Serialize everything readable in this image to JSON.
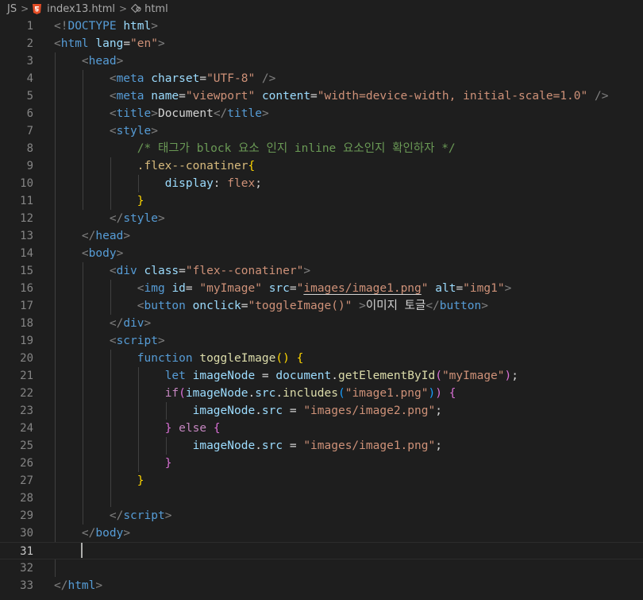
{
  "breadcrumb": {
    "root": "JS",
    "file": "index13.html",
    "element": "html",
    "file_icon": "html5-icon",
    "element_icon": "tag-icon"
  },
  "editor": {
    "active_line": 31,
    "lines": [
      [
        {
          "t": "<!",
          "c": "t-punc"
        },
        {
          "t": "DOCTYPE",
          "c": "t-tag"
        },
        {
          "t": " ",
          "c": "t-text"
        },
        {
          "t": "html",
          "c": "t-attr"
        },
        {
          "t": ">",
          "c": "t-punc"
        }
      ],
      [
        {
          "t": "<",
          "c": "t-punc"
        },
        {
          "t": "html",
          "c": "t-tag"
        },
        {
          "t": " ",
          "c": "t-text"
        },
        {
          "t": "lang",
          "c": "t-attr"
        },
        {
          "t": "=",
          "c": "t-text"
        },
        {
          "t": "\"en\"",
          "c": "t-str"
        },
        {
          "t": ">",
          "c": "t-punc"
        }
      ],
      [
        {
          "t": "    ",
          "c": "t-text"
        },
        {
          "t": "<",
          "c": "t-punc"
        },
        {
          "t": "head",
          "c": "t-tag"
        },
        {
          "t": ">",
          "c": "t-punc"
        }
      ],
      [
        {
          "t": "        ",
          "c": "t-text"
        },
        {
          "t": "<",
          "c": "t-punc"
        },
        {
          "t": "meta",
          "c": "t-tag"
        },
        {
          "t": " ",
          "c": "t-text"
        },
        {
          "t": "charset",
          "c": "t-attr"
        },
        {
          "t": "=",
          "c": "t-text"
        },
        {
          "t": "\"UTF-8\"",
          "c": "t-str"
        },
        {
          "t": " ",
          "c": "t-text"
        },
        {
          "t": "/>",
          "c": "t-punc"
        }
      ],
      [
        {
          "t": "        ",
          "c": "t-text"
        },
        {
          "t": "<",
          "c": "t-punc"
        },
        {
          "t": "meta",
          "c": "t-tag"
        },
        {
          "t": " ",
          "c": "t-text"
        },
        {
          "t": "name",
          "c": "t-attr"
        },
        {
          "t": "=",
          "c": "t-text"
        },
        {
          "t": "\"viewport\"",
          "c": "t-str"
        },
        {
          "t": " ",
          "c": "t-text"
        },
        {
          "t": "content",
          "c": "t-attr"
        },
        {
          "t": "=",
          "c": "t-text"
        },
        {
          "t": "\"width=device-width, initial-scale=1.0\"",
          "c": "t-str"
        },
        {
          "t": " ",
          "c": "t-text"
        },
        {
          "t": "/>",
          "c": "t-punc"
        }
      ],
      [
        {
          "t": "        ",
          "c": "t-text"
        },
        {
          "t": "<",
          "c": "t-punc"
        },
        {
          "t": "title",
          "c": "t-tag"
        },
        {
          "t": ">",
          "c": "t-punc"
        },
        {
          "t": "Document",
          "c": "t-text"
        },
        {
          "t": "</",
          "c": "t-punc"
        },
        {
          "t": "title",
          "c": "t-tag"
        },
        {
          "t": ">",
          "c": "t-punc"
        }
      ],
      [
        {
          "t": "        ",
          "c": "t-text"
        },
        {
          "t": "<",
          "c": "t-punc"
        },
        {
          "t": "style",
          "c": "t-tag"
        },
        {
          "t": ">",
          "c": "t-punc"
        }
      ],
      [
        {
          "t": "            ",
          "c": "t-text"
        },
        {
          "t": "/* 태그가 block 요소 인지 inline 요소인지 확인하자 */",
          "c": "t-com"
        }
      ],
      [
        {
          "t": "            ",
          "c": "t-text"
        },
        {
          "t": ".flex--conatiner",
          "c": "t-sel"
        },
        {
          "t": "{",
          "c": "b1"
        }
      ],
      [
        {
          "t": "                ",
          "c": "t-text"
        },
        {
          "t": "display",
          "c": "t-prop"
        },
        {
          "t": ": ",
          "c": "t-text"
        },
        {
          "t": "flex",
          "c": "t-str"
        },
        {
          "t": ";",
          "c": "t-text"
        }
      ],
      [
        {
          "t": "            ",
          "c": "t-text"
        },
        {
          "t": "}",
          "c": "b1"
        }
      ],
      [
        {
          "t": "        ",
          "c": "t-text"
        },
        {
          "t": "</",
          "c": "t-punc"
        },
        {
          "t": "style",
          "c": "t-tag"
        },
        {
          "t": ">",
          "c": "t-punc"
        }
      ],
      [
        {
          "t": "    ",
          "c": "t-text"
        },
        {
          "t": "</",
          "c": "t-punc"
        },
        {
          "t": "head",
          "c": "t-tag"
        },
        {
          "t": ">",
          "c": "t-punc"
        }
      ],
      [
        {
          "t": "    ",
          "c": "t-text"
        },
        {
          "t": "<",
          "c": "t-punc"
        },
        {
          "t": "body",
          "c": "t-tag"
        },
        {
          "t": ">",
          "c": "t-punc"
        }
      ],
      [
        {
          "t": "        ",
          "c": "t-text"
        },
        {
          "t": "<",
          "c": "t-punc"
        },
        {
          "t": "div",
          "c": "t-tag"
        },
        {
          "t": " ",
          "c": "t-text"
        },
        {
          "t": "class",
          "c": "t-attr"
        },
        {
          "t": "=",
          "c": "t-text"
        },
        {
          "t": "\"flex--conatiner\"",
          "c": "t-str"
        },
        {
          "t": ">",
          "c": "t-punc"
        }
      ],
      [
        {
          "t": "            ",
          "c": "t-text"
        },
        {
          "t": "<",
          "c": "t-punc"
        },
        {
          "t": "img",
          "c": "t-tag"
        },
        {
          "t": " ",
          "c": "t-text"
        },
        {
          "t": "id",
          "c": "t-attr"
        },
        {
          "t": "= ",
          "c": "t-text"
        },
        {
          "t": "\"myImage\"",
          "c": "t-str"
        },
        {
          "t": " ",
          "c": "t-text"
        },
        {
          "t": "src",
          "c": "t-attr"
        },
        {
          "t": "=",
          "c": "t-text"
        },
        {
          "t": "\"",
          "c": "t-str"
        },
        {
          "t": "images/image1.png",
          "c": "t-str u"
        },
        {
          "t": "\"",
          "c": "t-str"
        },
        {
          "t": " ",
          "c": "t-text"
        },
        {
          "t": "alt",
          "c": "t-attr"
        },
        {
          "t": "=",
          "c": "t-text"
        },
        {
          "t": "\"img1\"",
          "c": "t-str"
        },
        {
          "t": ">",
          "c": "t-punc"
        }
      ],
      [
        {
          "t": "            ",
          "c": "t-text"
        },
        {
          "t": "<",
          "c": "t-punc"
        },
        {
          "t": "button",
          "c": "t-tag"
        },
        {
          "t": " ",
          "c": "t-text"
        },
        {
          "t": "onclick",
          "c": "t-attr"
        },
        {
          "t": "=",
          "c": "t-text"
        },
        {
          "t": "\"toggleImage()\"",
          "c": "t-str"
        },
        {
          "t": " ",
          "c": "t-text"
        },
        {
          "t": ">",
          "c": "t-punc"
        },
        {
          "t": "이미지 토글",
          "c": "t-text"
        },
        {
          "t": "</",
          "c": "t-punc"
        },
        {
          "t": "button",
          "c": "t-tag"
        },
        {
          "t": ">",
          "c": "t-punc"
        }
      ],
      [
        {
          "t": "        ",
          "c": "t-text"
        },
        {
          "t": "</",
          "c": "t-punc"
        },
        {
          "t": "div",
          "c": "t-tag"
        },
        {
          "t": ">",
          "c": "t-punc"
        }
      ],
      [
        {
          "t": "        ",
          "c": "t-text"
        },
        {
          "t": "<",
          "c": "t-punc"
        },
        {
          "t": "script",
          "c": "t-tag"
        },
        {
          "t": ">",
          "c": "t-punc"
        }
      ],
      [
        {
          "t": "            ",
          "c": "t-text"
        },
        {
          "t": "function",
          "c": "t-key"
        },
        {
          "t": " ",
          "c": "t-text"
        },
        {
          "t": "toggleImage",
          "c": "t-fn"
        },
        {
          "t": "()",
          "c": "b1"
        },
        {
          "t": " ",
          "c": "t-text"
        },
        {
          "t": "{",
          "c": "b1"
        }
      ],
      [
        {
          "t": "                ",
          "c": "t-text"
        },
        {
          "t": "let",
          "c": "t-key"
        },
        {
          "t": " ",
          "c": "t-text"
        },
        {
          "t": "imageNode",
          "c": "t-var"
        },
        {
          "t": " = ",
          "c": "t-text"
        },
        {
          "t": "document",
          "c": "t-var"
        },
        {
          "t": ".",
          "c": "t-text"
        },
        {
          "t": "getElementById",
          "c": "t-fn"
        },
        {
          "t": "(",
          "c": "b2"
        },
        {
          "t": "\"myImage\"",
          "c": "t-str"
        },
        {
          "t": ")",
          "c": "b2"
        },
        {
          "t": ";",
          "c": "t-text"
        }
      ],
      [
        {
          "t": "                ",
          "c": "t-text"
        },
        {
          "t": "if",
          "c": "t-ctrl"
        },
        {
          "t": "(",
          "c": "b2"
        },
        {
          "t": "imageNode",
          "c": "t-var"
        },
        {
          "t": ".",
          "c": "t-text"
        },
        {
          "t": "src",
          "c": "t-var"
        },
        {
          "t": ".",
          "c": "t-text"
        },
        {
          "t": "includes",
          "c": "t-fn"
        },
        {
          "t": "(",
          "c": "b3"
        },
        {
          "t": "\"image1.png\"",
          "c": "t-str"
        },
        {
          "t": ")",
          "c": "b3"
        },
        {
          "t": ")",
          "c": "b2"
        },
        {
          "t": " ",
          "c": "t-text"
        },
        {
          "t": "{",
          "c": "b2"
        }
      ],
      [
        {
          "t": "                    ",
          "c": "t-text"
        },
        {
          "t": "imageNode",
          "c": "t-var"
        },
        {
          "t": ".",
          "c": "t-text"
        },
        {
          "t": "src",
          "c": "t-var"
        },
        {
          "t": " = ",
          "c": "t-text"
        },
        {
          "t": "\"images/image2.png\"",
          "c": "t-str"
        },
        {
          "t": ";",
          "c": "t-text"
        }
      ],
      [
        {
          "t": "                ",
          "c": "t-text"
        },
        {
          "t": "}",
          "c": "b2"
        },
        {
          "t": " ",
          "c": "t-text"
        },
        {
          "t": "else",
          "c": "t-ctrl"
        },
        {
          "t": " ",
          "c": "t-text"
        },
        {
          "t": "{",
          "c": "b2"
        }
      ],
      [
        {
          "t": "                    ",
          "c": "t-text"
        },
        {
          "t": "imageNode",
          "c": "t-var"
        },
        {
          "t": ".",
          "c": "t-text"
        },
        {
          "t": "src",
          "c": "t-var"
        },
        {
          "t": " = ",
          "c": "t-text"
        },
        {
          "t": "\"images/image1.png\"",
          "c": "t-str"
        },
        {
          "t": ";",
          "c": "t-text"
        }
      ],
      [
        {
          "t": "                ",
          "c": "t-text"
        },
        {
          "t": "}",
          "c": "b2"
        }
      ],
      [
        {
          "t": "            ",
          "c": "t-text"
        },
        {
          "t": "}",
          "c": "b1"
        }
      ],
      [],
      [
        {
          "t": "        ",
          "c": "t-text"
        },
        {
          "t": "</",
          "c": "t-punc"
        },
        {
          "t": "script",
          "c": "t-tag"
        },
        {
          "t": ">",
          "c": "t-punc"
        }
      ],
      [
        {
          "t": "    ",
          "c": "t-text"
        },
        {
          "t": "</",
          "c": "t-punc"
        },
        {
          "t": "body",
          "c": "t-tag"
        },
        {
          "t": ">",
          "c": "t-punc"
        }
      ],
      [],
      [],
      [
        {
          "t": "</",
          "c": "t-punc"
        },
        {
          "t": "html",
          "c": "t-tag"
        },
        {
          "t": ">",
          "c": "t-punc"
        }
      ]
    ]
  }
}
